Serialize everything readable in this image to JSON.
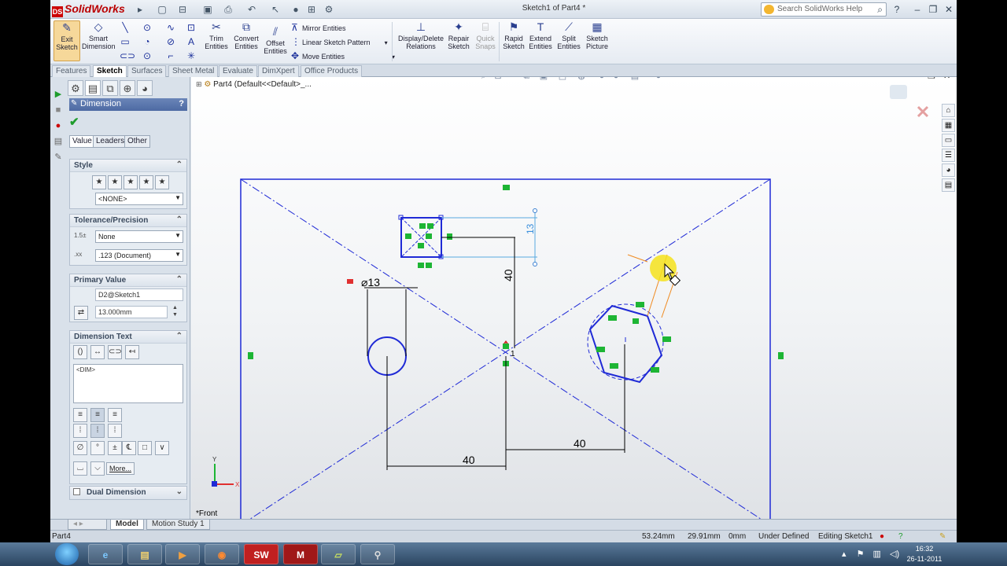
{
  "app": {
    "logo_text": "SolidWorks",
    "document_title": "Sketch1 of Part4 *",
    "search_placeholder": "Search SolidWorks Help"
  },
  "quick_access": [
    "new-icon",
    "open-icon",
    "save-icon",
    "print-icon",
    "undo-icon",
    "select-icon",
    "rebuild-icon",
    "file-properties-icon",
    "options-icon"
  ],
  "commands": {
    "exit_sketch": "Exit Sketch",
    "smart_dimension": "Smart Dimension",
    "trim_entities": "Trim Entities",
    "convert_entities": "Convert Entities",
    "offset_entities": "Offset Entities",
    "mirror_entities": "Mirror Entities",
    "linear_sketch_pattern": "Linear Sketch Pattern",
    "move_entities": "Move Entities",
    "display_delete_relations": "Display/Delete Relations",
    "repair_sketch": "Repair Sketch",
    "quick_snaps": "Quick Snaps",
    "rapid_sketch": "Rapid Sketch",
    "extend_entities": "Extend Entities",
    "split_entities": "Split Entities",
    "sketch_picture": "Sketch Picture"
  },
  "tabs": [
    {
      "label": "Features",
      "active": false
    },
    {
      "label": "Sketch",
      "active": true
    },
    {
      "label": "Surfaces",
      "active": false
    },
    {
      "label": "Sheet Metal",
      "active": false
    },
    {
      "label": "Evaluate",
      "active": false
    },
    {
      "label": "DimXpert",
      "active": false
    },
    {
      "label": "Office Products",
      "active": false
    }
  ],
  "property_manager": {
    "title": "Dimension",
    "help": "?",
    "sub_tabs": [
      "Value",
      "Leaders",
      "Other"
    ],
    "style": {
      "title": "Style",
      "dropdown": "<NONE>"
    },
    "tolerance": {
      "title": "Tolerance/Precision",
      "type": "None",
      "precision": ".123 (Document)"
    },
    "primary_value": {
      "title": "Primary Value",
      "name": "D2@Sketch1",
      "value": "13.000mm"
    },
    "dimension_text": {
      "title": "Dimension Text",
      "text": "<DIM>",
      "more_button": "More..."
    },
    "dual_dimension": {
      "title": "Dual Dimension"
    }
  },
  "tree": {
    "root": "Part4  (Default<<Default>_..."
  },
  "view_label": "*Front",
  "sketch_dimensions": {
    "diameter": "13",
    "vertical_main": "40",
    "vertical_small": "13",
    "horizontal_left": "40",
    "horizontal_right": "40"
  },
  "model_tabs": [
    {
      "label": "Model",
      "active": true
    },
    {
      "label": "Motion Study 1",
      "active": false
    }
  ],
  "status": {
    "part": "Part4",
    "x": "53.24mm",
    "y": "29.91mm",
    "z": "0mm",
    "definition": "Under Defined",
    "editing": "Editing Sketch1"
  },
  "taskbar": {
    "apps": [
      "ie-icon",
      "explorer-icon",
      "media-player-icon",
      "firefox-icon",
      "solidworks-icon",
      "matlab-icon",
      "notes-icon",
      "usb-icon"
    ],
    "time": "16:32",
    "date": "26-11-2011"
  },
  "colors": {
    "sketch_blue": "#1f2ad6",
    "relation_green": "#1db534",
    "highlight_yellow": "#f5e21c",
    "header_blue": "#4d6aa3"
  }
}
